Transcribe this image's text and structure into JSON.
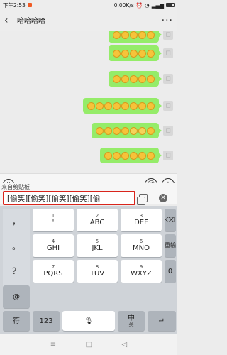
{
  "status": {
    "time": "下午2:53",
    "net_speed": "0.00K/s",
    "icons": [
      "notification-icon",
      "alarm-icon",
      "wifi-icon",
      "signal-icon",
      "battery-icon"
    ]
  },
  "header": {
    "back_icon": "back-arrow-icon",
    "title": "哈哈哈哈",
    "more_icon": "more-dots-icon"
  },
  "chat": {
    "bubble_color": "#95ec69",
    "messages": [
      {
        "from": "me",
        "content": "emoji-row",
        "emoji_count": 5
      },
      {
        "from": "me",
        "content": "emoji-row",
        "emoji_count": 5
      },
      {
        "from": "me",
        "content": "emoji-row",
        "emoji_count": 5
      },
      {
        "from": "me",
        "content": "emoji-row",
        "emoji_count": 8
      },
      {
        "from": "me",
        "content": "emoji-row",
        "emoji_count": 7
      },
      {
        "from": "me",
        "content": "emoji-row",
        "emoji_count": 6
      }
    ]
  },
  "input_bar": {
    "voice_icon": "voice-icon",
    "emoji_icon": "emoji-icon",
    "plus_icon": "plus-icon"
  },
  "clipboard": {
    "label": "来自剪贴板",
    "text": "[偷笑][偷笑][偷笑][偷笑][偷",
    "border_color": "#d9251c",
    "copy_icon": "copy-icon",
    "close_icon": "close-icon"
  },
  "keyboard": {
    "symbols": [
      "，",
      "。",
      "？",
      "！"
    ],
    "keys": [
      {
        "num": "1",
        "label": "'"
      },
      {
        "num": "2",
        "label": "ABC"
      },
      {
        "num": "3",
        "label": "DEF"
      },
      {
        "num": "4",
        "label": "GHI"
      },
      {
        "num": "5",
        "label": "JKL"
      },
      {
        "num": "6",
        "label": "MNO"
      },
      {
        "num": "7",
        "label": "PQRS"
      },
      {
        "num": "8",
        "label": "TUV"
      },
      {
        "num": "9",
        "label": "WXYZ"
      }
    ],
    "backspace_icon": "backspace-icon",
    "renew": "重输",
    "zero": "0",
    "at": "@",
    "bottom": {
      "symbol": "符",
      "numbers": "123",
      "space": "mic-icon",
      "lang": "中",
      "lang_sub": "英",
      "enter": "enter-icon"
    }
  },
  "nav": {
    "icons": [
      "menu-icon",
      "home-icon",
      "back-icon"
    ]
  }
}
